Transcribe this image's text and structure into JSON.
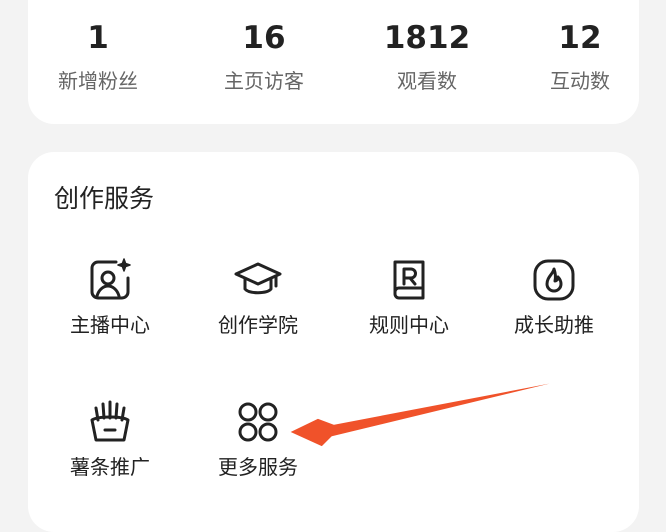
{
  "stats": [
    {
      "value": "1",
      "label": "新增粉丝"
    },
    {
      "value": "16",
      "label": "主页访客"
    },
    {
      "value": "1812",
      "label": "观看数"
    },
    {
      "value": "12",
      "label": "互动数"
    }
  ],
  "services": {
    "title": "创作服务",
    "items": [
      {
        "label": "主播中心",
        "icon": "anchor-center-icon"
      },
      {
        "label": "创作学院",
        "icon": "graduation-cap-icon"
      },
      {
        "label": "规则中心",
        "icon": "rules-book-icon"
      },
      {
        "label": "成长助推",
        "icon": "flame-icon"
      },
      {
        "label": "薯条推广",
        "icon": "fries-icon"
      },
      {
        "label": "更多服务",
        "icon": "grid-icon"
      }
    ]
  },
  "colors": {
    "accent_arrow": "#f0522a",
    "card_bg": "#ffffff",
    "page_bg": "#f3f3f3"
  }
}
